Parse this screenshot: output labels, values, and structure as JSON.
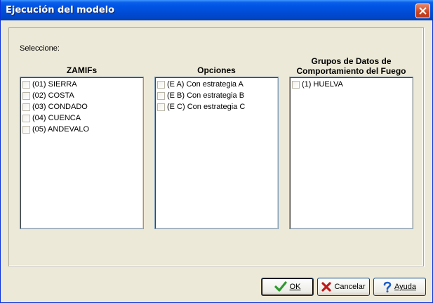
{
  "window": {
    "title": "Ejecución del modelo",
    "close_icon": "close-icon"
  },
  "form": {
    "prompt": "Seleccione:"
  },
  "lists": [
    {
      "header": "ZAMIFs",
      "items": [
        "(01) SIERRA",
        "(02) COSTA",
        "(03) CONDADO",
        "(04) CUENCA",
        "(05) ANDEVALO"
      ]
    },
    {
      "header": "Opciones",
      "items": [
        "(E A) Con estrategia A",
        "(E B) Con estrategia B",
        "(E C) Con estrategia C"
      ]
    },
    {
      "header_line1": "Grupos de Datos de",
      "header_line2": "Comportamiento del Fuego",
      "items": [
        "(1) HUELVA"
      ]
    }
  ],
  "buttons": {
    "ok": {
      "label": "OK",
      "icon": "checkmark-icon",
      "color": "#2e9a2e"
    },
    "cancel": {
      "label": "Cancelar",
      "icon": "x-icon",
      "color": "#c01818"
    },
    "help": {
      "label": "Ayuda",
      "icon": "question-icon",
      "color": "#1e5fc8"
    }
  }
}
